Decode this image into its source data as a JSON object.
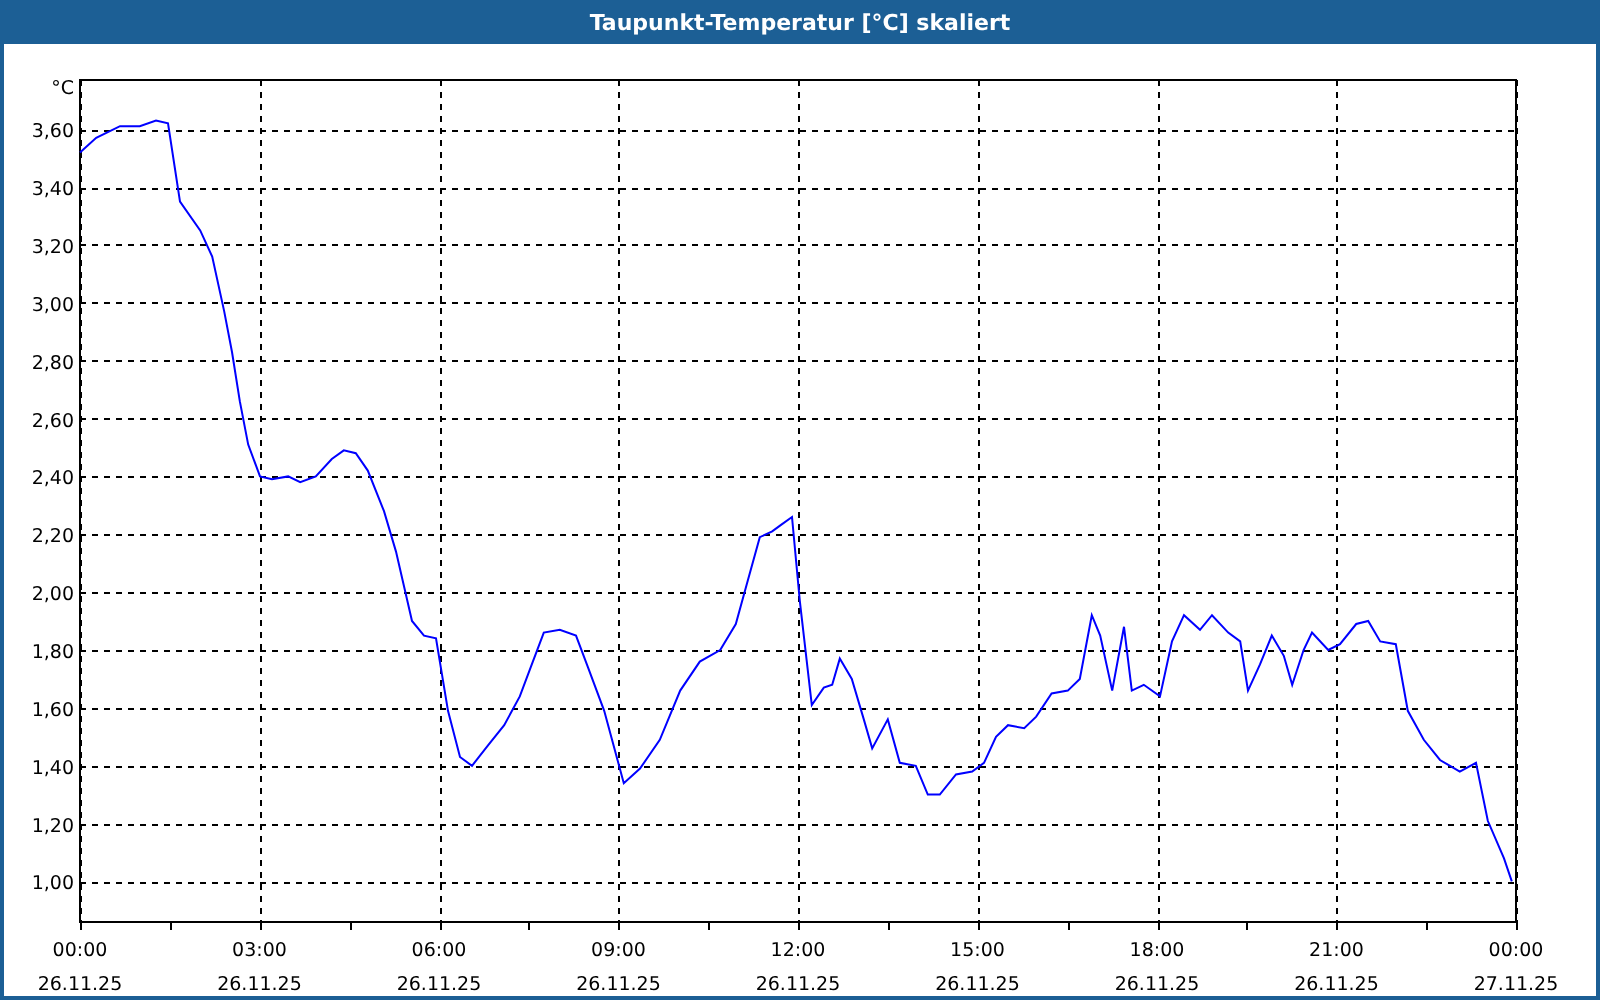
{
  "window": {
    "title": "Taupunkt-Temperatur [°C] skaliert"
  },
  "chart": {
    "x_axis_dates": [
      "26.11.25",
      "26.11.25",
      "26.11.25",
      "26.11.25",
      "26.11.25",
      "26.11.25",
      "26.11.25",
      "26.11.25",
      "27.11.25"
    ],
    "chart_data": {
      "type": "line",
      "ylabel": "°C",
      "grid": true,
      "xlim": [
        0,
        24
      ],
      "ylim": [
        0.86,
        3.77
      ],
      "yticks": [
        {
          "value": 1.0,
          "label": "1,00"
        },
        {
          "value": 1.2,
          "label": "1,20"
        },
        {
          "value": 1.4,
          "label": "1,40"
        },
        {
          "value": 1.6,
          "label": "1,60"
        },
        {
          "value": 1.8,
          "label": "1,80"
        },
        {
          "value": 2.0,
          "label": "2,00"
        },
        {
          "value": 2.2,
          "label": "2,20"
        },
        {
          "value": 2.4,
          "label": "2,40"
        },
        {
          "value": 2.6,
          "label": "2,60"
        },
        {
          "value": 2.8,
          "label": "2,80"
        },
        {
          "value": 3.0,
          "label": "3,00"
        },
        {
          "value": 3.2,
          "label": "3,20"
        },
        {
          "value": 3.4,
          "label": "3,40"
        },
        {
          "value": 3.6,
          "label": "3,60"
        }
      ],
      "xticks": [
        {
          "value": 0,
          "label": "00:00"
        },
        {
          "value": 3,
          "label": "03:00"
        },
        {
          "value": 6,
          "label": "06:00"
        },
        {
          "value": 9,
          "label": "09:00"
        },
        {
          "value": 12,
          "label": "12:00"
        },
        {
          "value": 15,
          "label": "15:00"
        },
        {
          "value": 18,
          "label": "18:00"
        },
        {
          "value": 21,
          "label": "21:00"
        },
        {
          "value": 24,
          "label": "00:00"
        }
      ],
      "x": [
        0,
        0.27,
        0.67,
        1.0,
        1.27,
        1.47,
        1.67,
        2.01,
        2.21,
        2.41,
        2.54,
        2.67,
        2.81,
        3.01,
        3.21,
        3.48,
        3.68,
        3.94,
        4.21,
        4.41,
        4.61,
        4.81,
        5.08,
        5.28,
        5.55,
        5.75,
        5.95,
        6.15,
        6.35,
        6.55,
        6.82,
        7.09,
        7.35,
        7.55,
        7.75,
        8.02,
        8.29,
        8.49,
        8.76,
        9.09,
        9.36,
        9.69,
        10.03,
        10.36,
        10.7,
        10.96,
        11.16,
        11.36,
        11.57,
        11.7,
        11.9,
        12.03,
        12.23,
        12.43,
        12.57,
        12.7,
        12.9,
        13.1,
        13.24,
        13.5,
        13.7,
        13.97,
        14.17,
        14.37,
        14.64,
        14.91,
        15.11,
        15.31,
        15.51,
        15.78,
        15.98,
        16.24,
        16.51,
        16.71,
        16.91,
        17.05,
        17.25,
        17.45,
        17.58,
        17.78,
        18.05,
        18.25,
        18.45,
        18.72,
        18.92,
        19.19,
        19.39,
        19.52,
        19.72,
        19.92,
        20.12,
        20.26,
        20.45,
        20.59,
        20.86,
        21.06,
        21.33,
        21.53,
        21.73,
        21.99,
        22.19,
        22.46,
        22.73,
        23.06,
        23.33,
        23.53,
        23.8,
        23.93
      ],
      "series": [
        {
          "color": "#0000ff",
          "values": [
            3.52,
            3.57,
            3.61,
            3.61,
            3.63,
            3.62,
            3.35,
            3.25,
            3.16,
            2.97,
            2.83,
            2.66,
            2.51,
            2.4,
            2.39,
            2.4,
            2.38,
            2.4,
            2.46,
            2.49,
            2.48,
            2.42,
            2.28,
            2.14,
            1.9,
            1.85,
            1.84,
            1.59,
            1.43,
            1.4,
            1.47,
            1.54,
            1.64,
            1.75,
            1.86,
            1.87,
            1.85,
            1.74,
            1.59,
            1.34,
            1.39,
            1.49,
            1.66,
            1.76,
            1.8,
            1.89,
            2.04,
            2.19,
            2.21,
            2.23,
            2.26,
            1.97,
            1.61,
            1.67,
            1.68,
            1.77,
            1.7,
            1.56,
            1.46,
            1.56,
            1.41,
            1.4,
            1.3,
            1.3,
            1.37,
            1.38,
            1.41,
            1.5,
            1.54,
            1.53,
            1.57,
            1.65,
            1.66,
            1.7,
            1.92,
            1.85,
            1.66,
            1.88,
            1.66,
            1.68,
            1.64,
            1.83,
            1.92,
            1.87,
            1.92,
            1.86,
            1.83,
            1.66,
            1.75,
            1.85,
            1.78,
            1.68,
            1.8,
            1.86,
            1.8,
            1.82,
            1.89,
            1.9,
            1.83,
            1.82,
            1.59,
            1.49,
            1.42,
            1.38,
            1.41,
            1.21,
            1.08,
            1.0
          ]
        }
      ]
    }
  }
}
